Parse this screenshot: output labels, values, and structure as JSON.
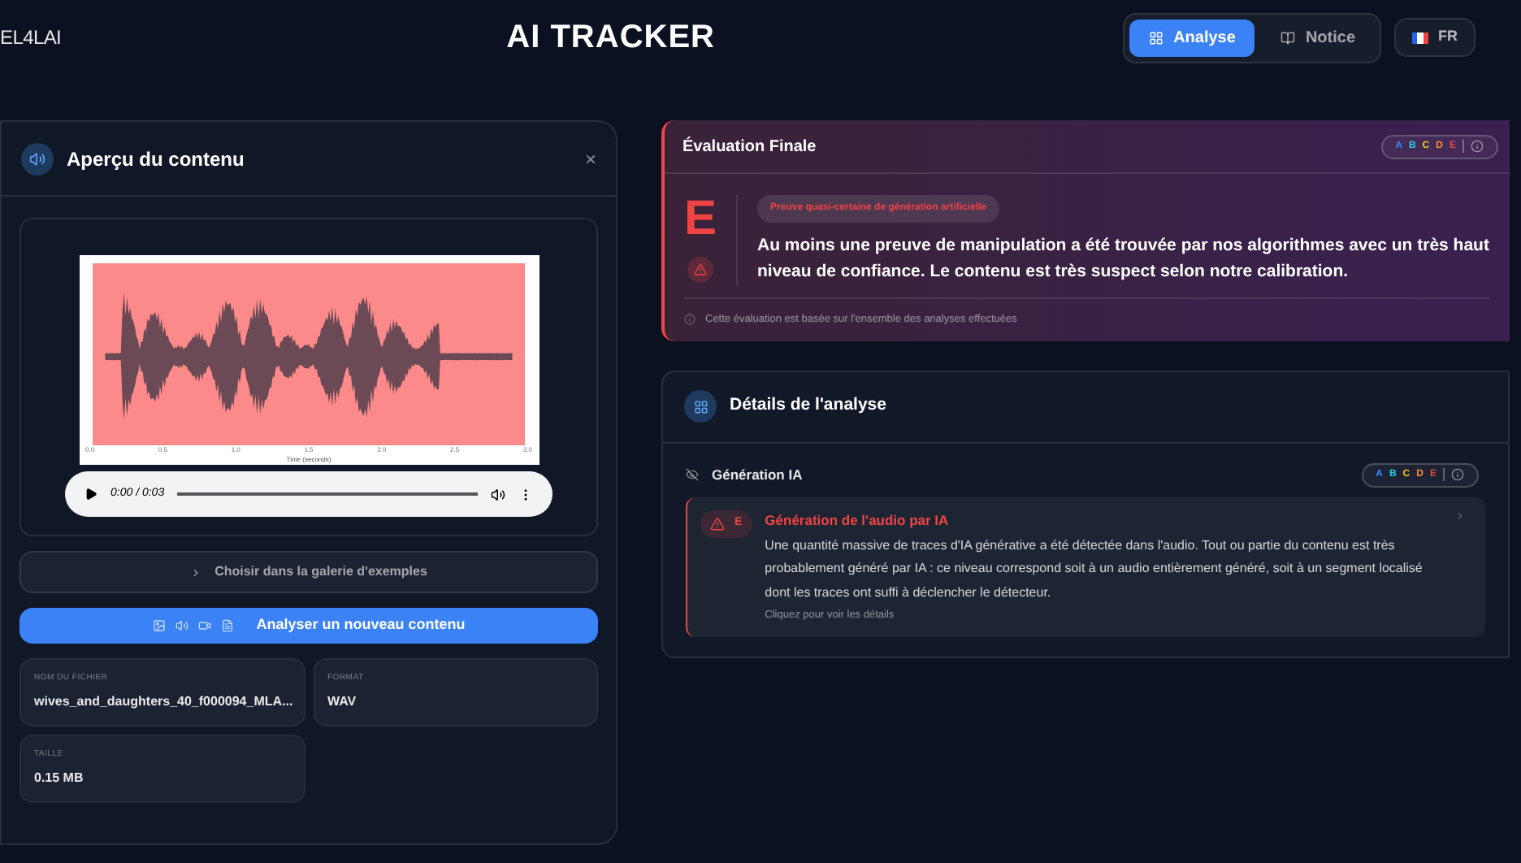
{
  "header": {
    "logo": "EL4LAI",
    "title": "AI TRACKER",
    "nav": [
      {
        "label": "Analyse",
        "kind": "grid",
        "selected": true
      },
      {
        "label": "Notice",
        "kind": "book",
        "selected": false
      }
    ],
    "language": "FR"
  },
  "preview": {
    "title": "Aperçu du contenu",
    "close": "×",
    "waveform": {
      "ticks": [
        "0.0",
        "0.5",
        "1.0",
        "1.5",
        "2.0",
        "2.5",
        "3.0"
      ],
      "xlabel": "Time (seconds)"
    },
    "player": {
      "time": "0:00 / 0:03"
    },
    "gallery_button": "Choisir dans la galerie d'exemples",
    "analyze_button": "Analyser un nouveau contenu",
    "fields": [
      {
        "label": "NOM DU FICHIER",
        "value": "wives_and_daughters_40_f000094_MLA..."
      },
      {
        "label": "FORMAT",
        "value": "WAV"
      },
      {
        "label": "TAILLE",
        "value": "0.15 MB"
      }
    ]
  },
  "final": {
    "title": "Évaluation Finale",
    "scale": [
      {
        "letter": "A",
        "color": "#3b82f6"
      },
      {
        "letter": "B",
        "color": "#22d3ee"
      },
      {
        "letter": "C",
        "color": "#facc15"
      },
      {
        "letter": "D",
        "color": "#fb923c"
      },
      {
        "letter": "E",
        "color": "#ef4444"
      }
    ],
    "grade": "E",
    "badge": "Preuve quasi-certaine de génération artificielle",
    "text": "Au moins une preuve de manipulation a été trouvée par nos algorithmes avec un très haut niveau de confiance. Le contenu est très suspect selon notre calibration.",
    "note": "Cette évaluation est basée sur l'ensemble des analyses effectuées"
  },
  "details": {
    "title": "Détails de l'analyse",
    "section": "Génération IA",
    "scale": [
      {
        "letter": "A",
        "color": "#3b82f6"
      },
      {
        "letter": "B",
        "color": "#22d3ee"
      },
      {
        "letter": "C",
        "color": "#facc15"
      },
      {
        "letter": "D",
        "color": "#fb923c"
      },
      {
        "letter": "E",
        "color": "#ef4444"
      }
    ],
    "item": {
      "grade": "E",
      "title": "Génération de l'audio par IA",
      "text": "Une quantité massive de traces d'IA générative a été détectée dans l'audio. Tout ou partie du contenu est très probablement généré par IA : ce niveau correspond soit à un audio entièrement généré, soit à un segment localisé dont les traces ont suffi à déclencher le détecteur.",
      "link": "Cliquez pour voir les détails"
    }
  }
}
